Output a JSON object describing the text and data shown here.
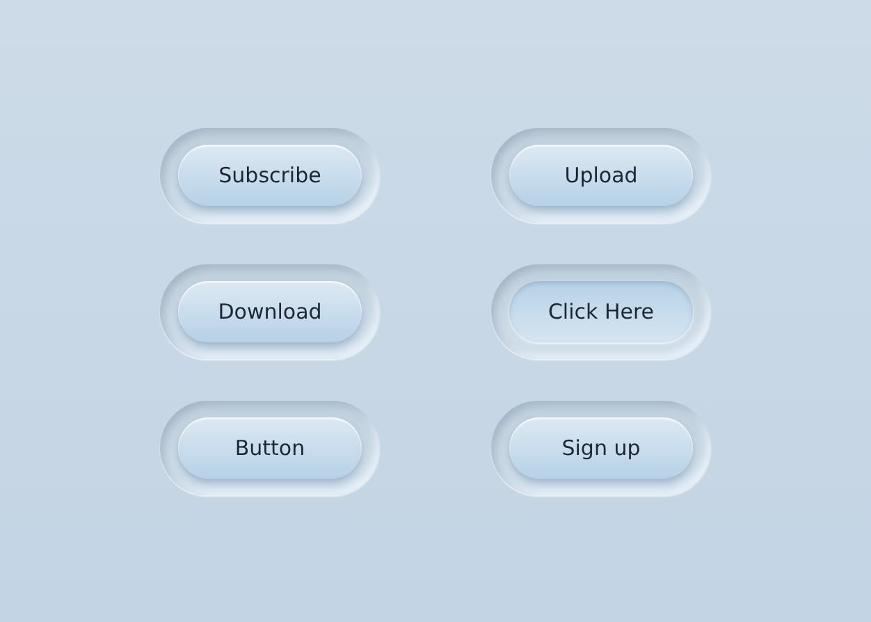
{
  "buttons": [
    {
      "label": "Subscribe",
      "pressed": false
    },
    {
      "label": "Upload",
      "pressed": false
    },
    {
      "label": "Download",
      "pressed": false
    },
    {
      "label": "Click Here",
      "pressed": true
    },
    {
      "label": "Button",
      "pressed": false
    },
    {
      "label": "Sign up",
      "pressed": false
    }
  ]
}
